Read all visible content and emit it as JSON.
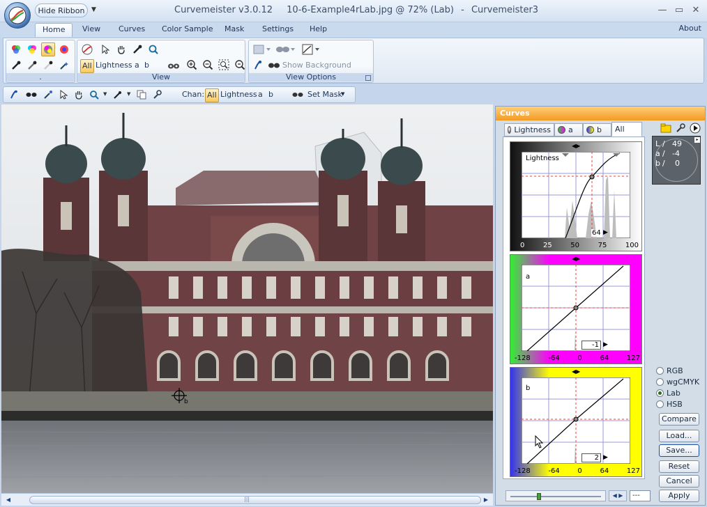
{
  "app": {
    "hide_ribbon": "Hide Ribbon",
    "title_app": "Curvemeister v3.0.12",
    "title_doc": "10-6-Example4rLab.jpg @ 72% (Lab)",
    "title_sep": "-",
    "title_suffix": "Curvemeister3"
  },
  "window_controls": {
    "minimize": "—",
    "restore": "▭",
    "close": "✕"
  },
  "tabs": [
    {
      "label": "Home",
      "active": true
    },
    {
      "label": "View"
    },
    {
      "label": "Curves"
    },
    {
      "label": "Color Sample"
    },
    {
      "label": "Mask"
    },
    {
      "label": "Settings"
    },
    {
      "label": "Help"
    }
  ],
  "about": "About",
  "ribbon": {
    "group1_label": ".",
    "view_group": {
      "label": "View",
      "channels": {
        "all": "All",
        "lightness": "Lightness",
        "a": "a",
        "b": "b"
      }
    },
    "view_options": {
      "label": "View Options",
      "show_bg": "Show Background Layers"
    }
  },
  "toolbar2": {
    "chan_label": "Chan:",
    "all": "All",
    "lightness": "Lightness",
    "a": "a",
    "b": "b",
    "set_mask": "Set Mask"
  },
  "curves": {
    "title": "Curves",
    "tabs": [
      {
        "label": "Lightness"
      },
      {
        "label": "a"
      },
      {
        "label": "b"
      },
      {
        "label": "All",
        "active": true
      }
    ],
    "lightness": {
      "label": "Lightness",
      "value": "64",
      "ticks": [
        "0",
        "25",
        "50",
        "75",
        "100"
      ]
    },
    "a": {
      "label": "a",
      "value": "-1",
      "ticks": [
        "-128",
        "-64",
        "0",
        "64",
        "127"
      ]
    },
    "b": {
      "label": "b",
      "value": "2",
      "ticks": [
        "-128",
        "-64",
        "0",
        "64",
        "127"
      ]
    },
    "readout": {
      "l_label": "L",
      "l_value": "49",
      "a_label": "a",
      "a_value": "-4",
      "b_label": "b",
      "b_value": "0"
    },
    "colorspaces": [
      {
        "label": "RGB"
      },
      {
        "label": "wgCMYK"
      },
      {
        "label": "Lab",
        "selected": true
      },
      {
        "label": "HSB"
      }
    ],
    "buttons": {
      "compare": "Compare",
      "load": "Load...",
      "save": "Save...",
      "reset": "Reset",
      "cancel": "Cancel",
      "apply": "Apply"
    },
    "bottom_field": "---"
  },
  "cursor_label": "b",
  "colors": {
    "accent_orange": "#f39a23",
    "ribbon_blue": "#c9daef",
    "channel_a": "#ff00ff",
    "channel_b": "#ffff00"
  }
}
